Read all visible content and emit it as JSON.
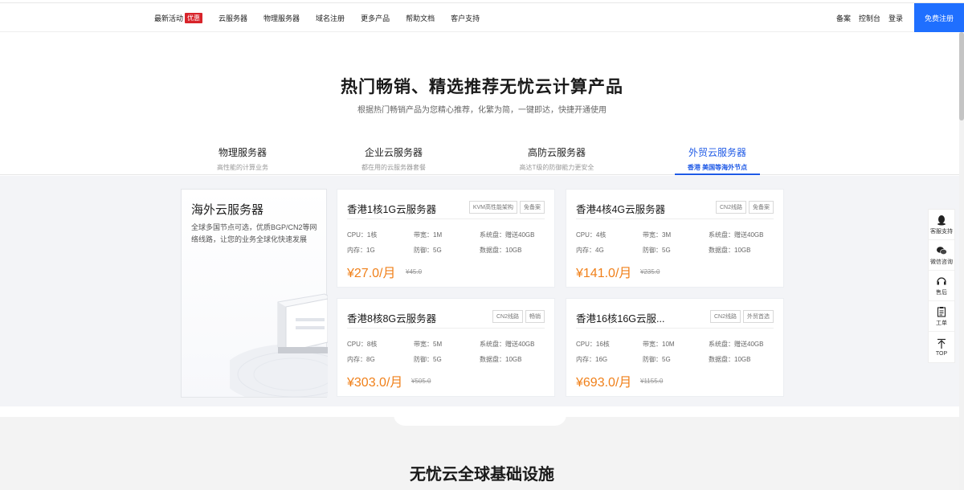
{
  "nav": {
    "items": [
      {
        "label": "最新活动",
        "badge": "优惠"
      },
      {
        "label": "云服务器"
      },
      {
        "label": "物理服务器"
      },
      {
        "label": "域名注册"
      },
      {
        "label": "更多产品"
      },
      {
        "label": "帮助文档"
      },
      {
        "label": "客户支持"
      }
    ],
    "right": [
      "备案",
      "控制台",
      "登录"
    ],
    "signup": "免费注册"
  },
  "hero": {
    "title": "热门畅销、精选推荐无忧云计算产品",
    "subtitle": "根据热门畅销产品为您精心推荐，化繁为简，一键即达，快捷开通使用"
  },
  "tabs": [
    {
      "label": "物理服务器",
      "desc": "高性能的计算业务"
    },
    {
      "label": "企业云服务器",
      "desc": "都在用的云服务器套餐"
    },
    {
      "label": "高防云服务器",
      "desc": "高达T级的防御能力更安全"
    },
    {
      "label": "外贸云服务器",
      "desc": "香港 美国等海外节点",
      "active": true
    }
  ],
  "side_card": {
    "title": "海外云服务器",
    "desc": "全球多国节点可选，优质BGP/CN2等网络线路，让您的业务全球化快速发展"
  },
  "cards": [
    {
      "title": "香港1核1G云服务器",
      "tags": [
        "KVM高性能架构",
        "免备案"
      ],
      "cpu": "CPU：1核",
      "bw": "带宽：1M",
      "sys": "系统盘：赠送40GB",
      "mem": "内存：1G",
      "ddos": "防御：5G",
      "data": "数据盘：10GB",
      "price": "¥27.0/月",
      "old": "¥45.0"
    },
    {
      "title": "香港4核4G云服务器",
      "tags": [
        "CN2线路",
        "免备案"
      ],
      "cpu": "CPU：4核",
      "bw": "带宽：3M",
      "sys": "系统盘：赠送40GB",
      "mem": "内存：4G",
      "ddos": "防御：5G",
      "data": "数据盘：10GB",
      "price": "¥141.0/月",
      "old": "¥235.0"
    },
    {
      "title": "香港8核8G云服务器",
      "tags": [
        "CN2线路",
        "畅销"
      ],
      "cpu": "CPU：8核",
      "bw": "带宽：5M",
      "sys": "系统盘：赠送40GB",
      "mem": "内存：8G",
      "ddos": "防御：5G",
      "data": "数据盘：10GB",
      "price": "¥303.0/月",
      "old": "¥505.0"
    },
    {
      "title": "香港16核16G云服...",
      "tags": [
        "CN2线路",
        "外贸首选"
      ],
      "cpu": "CPU：16核",
      "bw": "带宽：10M",
      "sys": "系统盘：赠送40GB",
      "mem": "内存：16G",
      "ddos": "防御：5G",
      "data": "数据盘：10GB",
      "price": "¥693.0/月",
      "old": "¥1155.0"
    }
  ],
  "floatbar": [
    {
      "label": "客服支持",
      "icon": "qq-icon"
    },
    {
      "label": "微信咨询",
      "icon": "wechat-icon"
    },
    {
      "label": "售后",
      "icon": "headset-icon"
    },
    {
      "label": "工单",
      "icon": "clipboard-icon"
    },
    {
      "label": "TOP",
      "icon": "arrow-up-icon"
    }
  ],
  "bottom": {
    "title": "无忧云全球基础设施"
  },
  "colors": {
    "primary": "#1f6fff",
    "price": "#f0801a",
    "badge": "#d8232a"
  }
}
